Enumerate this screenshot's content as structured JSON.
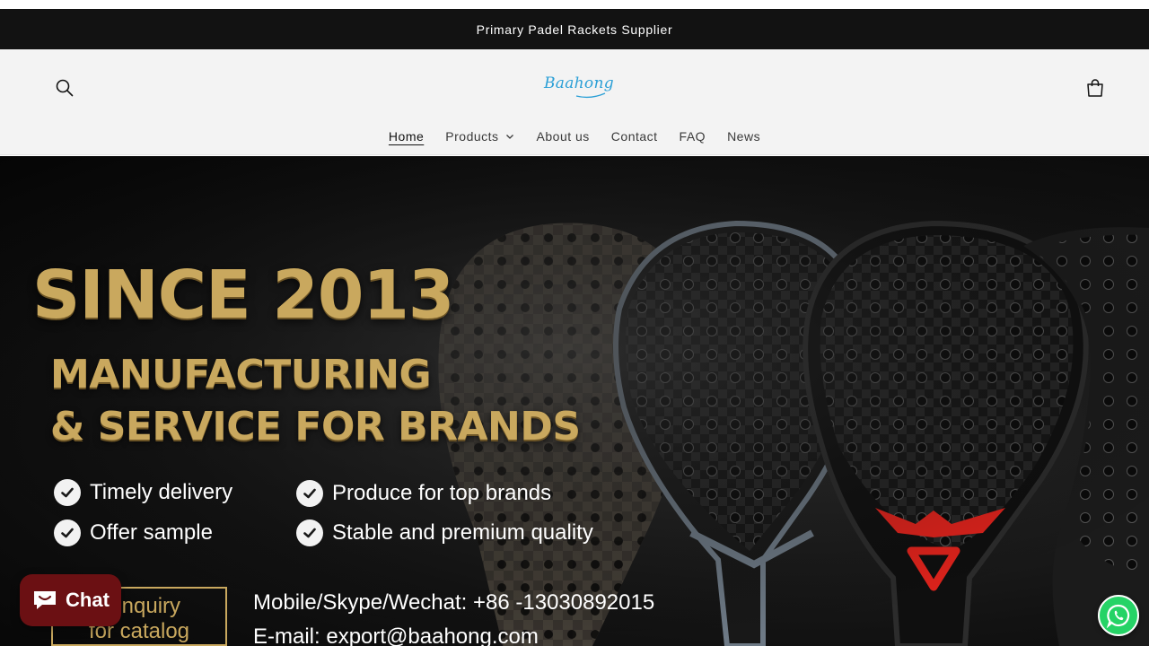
{
  "announcement": {
    "text": "Primary Padel Rackets Supplier"
  },
  "header": {
    "logo_text": "Baahong",
    "icons": {
      "search": "search-icon",
      "cart": "cart-icon"
    }
  },
  "nav": {
    "items": [
      {
        "label": "Home",
        "active": true
      },
      {
        "label": "Products",
        "has_dropdown": true
      },
      {
        "label": "About us"
      },
      {
        "label": "Contact"
      },
      {
        "label": "FAQ"
      },
      {
        "label": "News"
      }
    ]
  },
  "hero": {
    "headline": "SINCE 2013",
    "subline_1": "MANUFACTURING",
    "subline_2": "& SERVICE FOR BRANDS",
    "features": [
      "Timely delivery",
      "Produce for top brands",
      "Offer sample",
      "Stable and premium quality"
    ],
    "inquiry_line_1": "d Inquiry",
    "inquiry_line_2": "for catalog",
    "contact_phone": "Mobile/Skype/Wechat: +86 -13030892015",
    "contact_email": "E-mail: export@baahong.com",
    "gold_color": "#c9a85e",
    "accent_red": "#e0231c"
  },
  "widgets": {
    "chat_label": "Chat",
    "chat_color": "#6b1013",
    "whatsapp_color": "#25d366"
  }
}
